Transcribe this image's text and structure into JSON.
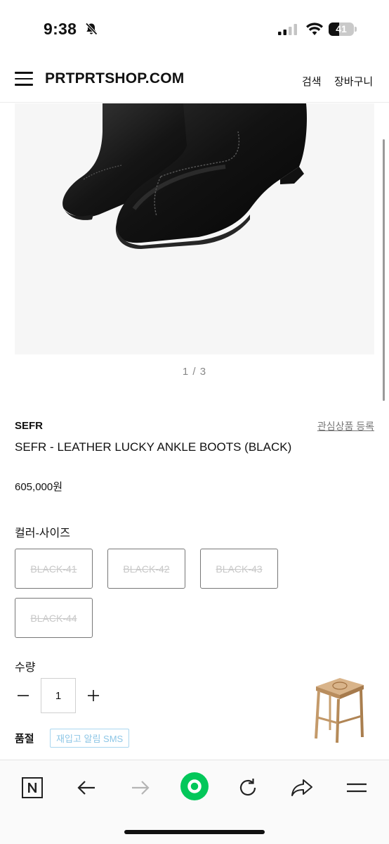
{
  "status_bar": {
    "time": "9:38",
    "battery": "41",
    "battery_level": 0.41
  },
  "header": {
    "logo": "PRTPRTSHOP.COM",
    "search": "검색",
    "cart": "장바구니"
  },
  "gallery": {
    "counter": "1 / 3"
  },
  "product": {
    "brand": "SEFR",
    "wishlist": "관심상품 등록",
    "name": "SEFR - LEATHER LUCKY ANKLE BOOTS (BLACK)",
    "price": "605,000원"
  },
  "options": {
    "label": "컬러-사이즈",
    "items": [
      {
        "label": "BLACK-41",
        "sold_out": true
      },
      {
        "label": "BLACK-42",
        "sold_out": true
      },
      {
        "label": "BLACK-43",
        "sold_out": true
      },
      {
        "label": "BLACK-44",
        "sold_out": true
      }
    ]
  },
  "quantity": {
    "label": "수량",
    "value": "1"
  },
  "stock": {
    "label": "품절",
    "restock_button": "재입고 알림 SMS"
  },
  "toolbar": {
    "icons": [
      "naver-n-icon",
      "back-arrow-icon",
      "forward-arrow-icon",
      "green-home-icon",
      "refresh-icon",
      "share-icon",
      "menu-icon"
    ],
    "accent_color": "#03c75a"
  }
}
